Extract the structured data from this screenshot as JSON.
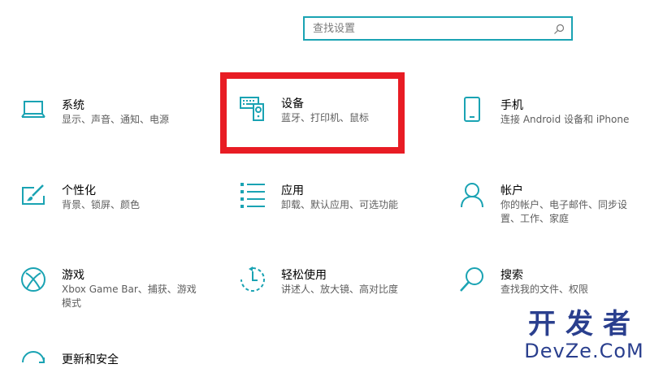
{
  "search": {
    "placeholder": "查找设置"
  },
  "tiles": [
    {
      "title": "系统",
      "desc": "显示、声音、通知、电源",
      "icon": "laptop-icon"
    },
    {
      "title": "设备",
      "desc": "蓝牙、打印机、鼠标",
      "icon": "devices-icon"
    },
    {
      "title": "手机",
      "desc": "连接 Android 设备和 iPhone",
      "icon": "phone-icon"
    },
    {
      "title": "个性化",
      "desc": "背景、锁屏、颜色",
      "icon": "personalization-icon"
    },
    {
      "title": "应用",
      "desc": "卸载、默认应用、可选功能",
      "icon": "apps-icon"
    },
    {
      "title": "帐户",
      "desc": "你的帐户、电子邮件、同步设置、工作、家庭",
      "icon": "account-icon"
    },
    {
      "title": "游戏",
      "desc": "Xbox Game Bar、捕获、游戏模式",
      "icon": "xbox-icon"
    },
    {
      "title": "轻松使用",
      "desc": "讲述人、放大镜、高对比度",
      "icon": "ease-of-access-icon"
    },
    {
      "title": "搜索",
      "desc": "查找我的文件、权限",
      "icon": "search-icon"
    },
    {
      "title": "更新和安全",
      "desc": "",
      "icon": "update-icon"
    }
  ],
  "watermark": {
    "line1": "开发者",
    "line2": "DevZe.CoM"
  },
  "colors": {
    "accent": "#1aa3b3",
    "highlight": "#e81c24",
    "watermark": "#2a3f8e"
  }
}
